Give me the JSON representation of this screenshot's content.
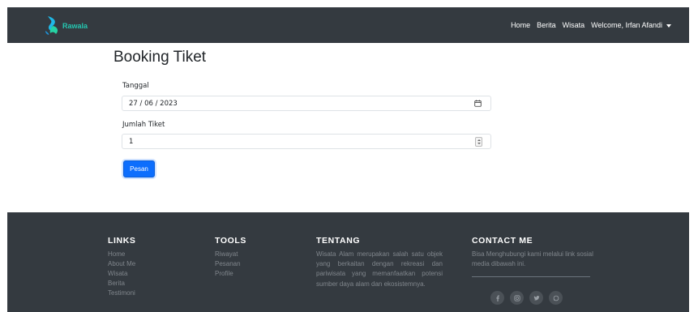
{
  "navbar": {
    "brand": "Rawala",
    "links": [
      "Home",
      "Berita",
      "Wisata"
    ],
    "user_menu": "Welcome, Irfan Afandi"
  },
  "main": {
    "title": "Booking Tiket",
    "date_label": "Tanggal",
    "date_value": "27 / 06 / 2023",
    "qty_label": "Jumlah Tiket",
    "qty_value": "1",
    "submit_label": "Pesan"
  },
  "footer": {
    "links": {
      "heading": "LINKS",
      "items": [
        "Home",
        "About Me",
        "Wisata",
        "Berita",
        "Testimoni"
      ]
    },
    "tools": {
      "heading": "TOOLS",
      "items": [
        "Riwayat",
        "Pesanan",
        "Profile"
      ]
    },
    "about": {
      "heading": "TENTANG",
      "text": "Wisata Alam merupakan salah satu objek yang berkaitan dengan rekreasi dan pariwisata yang memanfaatkan potensi sumber daya alam dan ekosistemnya."
    },
    "contact": {
      "heading": "CONTACT ME",
      "text": "Bisa Menghubungi kami melalui link sosial media dibawah ini.",
      "socials": [
        "facebook-icon",
        "instagram-icon",
        "twitter-icon",
        "whatsapp-icon"
      ]
    }
  },
  "colors": {
    "navbar_bg": "#343a40",
    "brand": "#25c6b0",
    "primary": "#0d6efd"
  }
}
